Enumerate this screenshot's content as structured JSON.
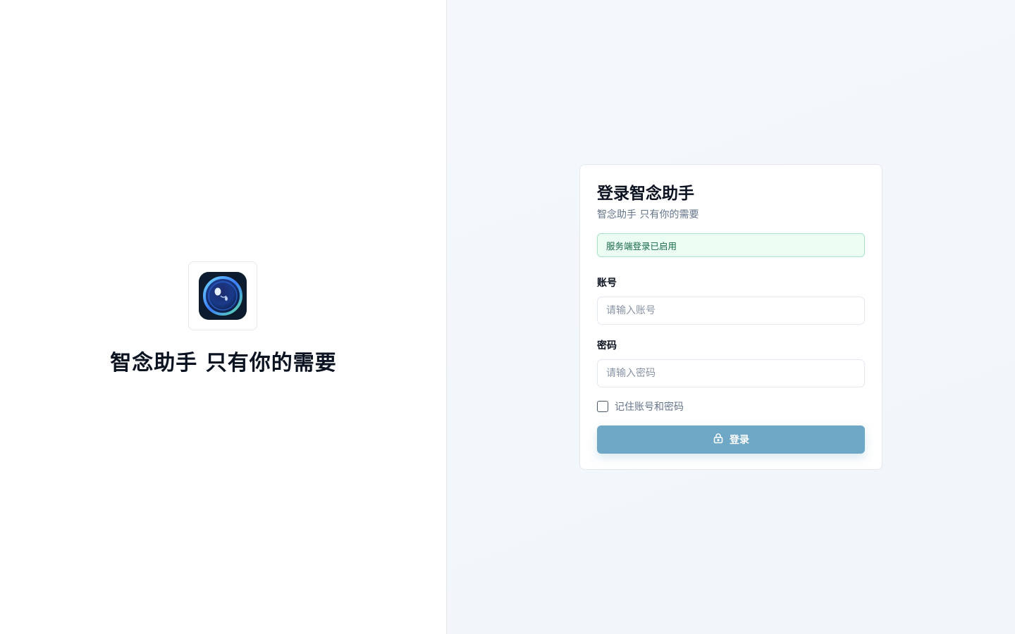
{
  "brand": {
    "slogan": "智念助手 只有你的需要",
    "logo_icon": "camera-lens-icon"
  },
  "login": {
    "title": "登录智念助手",
    "subtitle": "智念助手 只有你的需要",
    "status_message": "服务端登录已启用",
    "account_label": "账号",
    "account_placeholder": "请输入账号",
    "account_value": "",
    "password_label": "密码",
    "password_placeholder": "请输入密码",
    "password_value": "",
    "remember_label": "记住账号和密码",
    "remember_checked": false,
    "submit_label": "登录",
    "submit_icon": "lock-icon"
  },
  "colors": {
    "accent": "#6fa8c6",
    "success_bg": "#ecfdf4",
    "success_border": "#a7e3c4",
    "success_text": "#166a48",
    "logo_bg": "#0d1b2e"
  }
}
